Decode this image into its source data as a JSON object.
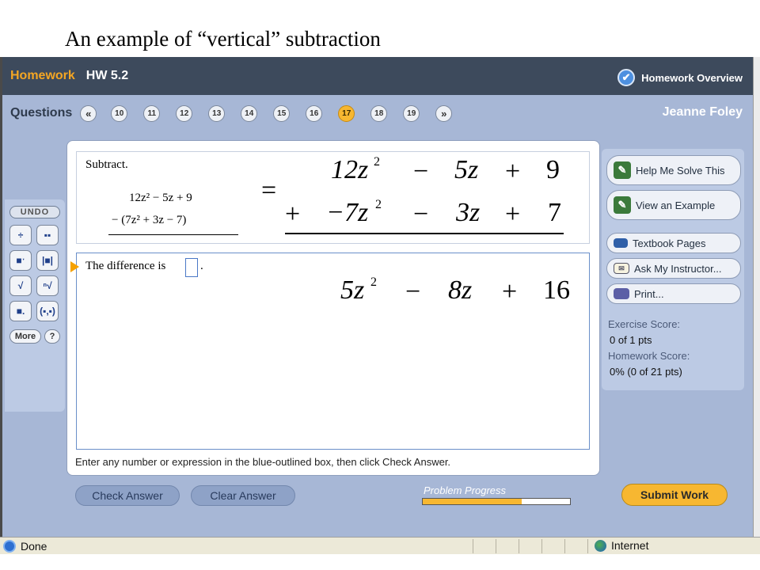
{
  "slide_title": "An example of “vertical” subtraction",
  "header": {
    "homework_label": "Homework",
    "homework_name": "HW 5.2",
    "overview_label": "Homework Overview",
    "overview_icon": "check-icon"
  },
  "questions": {
    "label": "Questions",
    "prev_glyph": "«",
    "next_glyph": "»",
    "numbers": [
      "10",
      "11",
      "12",
      "13",
      "14",
      "15",
      "16",
      "17",
      "18",
      "19"
    ],
    "active": "17",
    "user_name": "Jeanne Foley"
  },
  "toolbar": {
    "undo_label": "UNDO",
    "buttons": [
      "fraction-icon",
      "mixed-number-icon",
      "exponent-icon",
      "absolute-value-icon",
      "square-root-icon",
      "nth-root-icon",
      "decimal-icon",
      "interval-icon"
    ],
    "more_label": "More",
    "help_label": "?"
  },
  "question": {
    "instruction": "Subtract.",
    "line1": "12z² − 5z + 9",
    "line2": "− (7z² + 3z − 7)"
  },
  "answer": {
    "prompt": "The difference is",
    "period": "."
  },
  "footer_instruction": "Enter any number or expression in the blue-outlined box, then click Check Answer.",
  "side_panel": {
    "help_me_solve": "Help Me Solve This",
    "view_example": "View an Example",
    "textbook_pages": "Textbook Pages",
    "ask_instructor": "Ask My Instructor...",
    "print": "Print...",
    "exercise_score_label": "Exercise Score:",
    "exercise_score_value": "0 of 1 pts",
    "homework_score_label": "Homework Score:",
    "homework_score_value": "0% (0 of 21 pts)"
  },
  "bottom": {
    "check_answer": "Check Answer",
    "clear_answer": "Clear Answer",
    "progress_label": "Problem Progress",
    "progress_fraction": 0.67,
    "submit_work": "Submit Work"
  },
  "statusbar": {
    "done": "Done",
    "internet": "Internet"
  },
  "annotation": {
    "equals": "=",
    "row1": {
      "term1": "12z",
      "exp1": "2",
      "op1": "−",
      "term2": "5z",
      "op2": "+",
      "term3": "9"
    },
    "row2": {
      "op0": "+",
      "term1": "−7z",
      "exp1": "2",
      "op1": "−",
      "term2": "3z",
      "op2": "+",
      "term3": "7"
    },
    "result": {
      "term1": "5z",
      "exp1": "2",
      "op1": "−",
      "term2": "8z",
      "op2": "+",
      "term3": "16"
    }
  },
  "colors": {
    "header_bg": "#3d4a5c",
    "accent_orange": "#f7b731",
    "app_bg": "#a7b7d6"
  }
}
